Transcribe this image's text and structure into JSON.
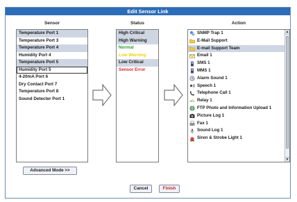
{
  "window": {
    "title": "Edit Sensor Link"
  },
  "columns": {
    "sensor": "Sensor",
    "status": "Status",
    "action": "Action"
  },
  "sensors": [
    "Temperature Port 1",
    "Temperature Port 3",
    "Temperature Port 4",
    "Humidity Port 4",
    "Temperature Port 5",
    "Humidity Port 5",
    "4-20mA Port 6",
    "Dry Contact Port 7",
    "Temperature Port 8",
    "Sound Detecter Port 1"
  ],
  "statuses": [
    {
      "label": "High Critical",
      "color": "#1a1a1a"
    },
    {
      "label": "High Warning",
      "color": "#1a1a1a"
    },
    {
      "label": "Normal",
      "color": "#2e9c2e"
    },
    {
      "label": "Low Warning",
      "color": "#e8d400"
    },
    {
      "label": "Low Critical",
      "color": "#1a1a1a"
    },
    {
      "label": "Sensor Error",
      "color": "#d12a2a"
    }
  ],
  "actions": [
    {
      "label": "SNMP Trap 1",
      "icon": "snmp-icon"
    },
    {
      "label": "E-Mail Support",
      "icon": "folder-icon"
    },
    {
      "label": "E-mail Support Team",
      "icon": "folder-icon"
    },
    {
      "label": "Email 1",
      "icon": "email-icon"
    },
    {
      "label": "SMS 1",
      "icon": "phone-icon"
    },
    {
      "label": "MMS 1",
      "icon": "phone-icon"
    },
    {
      "label": "Alarm Sound 1",
      "icon": "alarm-icon"
    },
    {
      "label": "Speech 1",
      "icon": "speech-icon"
    },
    {
      "label": "Telephone Call 1",
      "icon": "telephone-icon"
    },
    {
      "label": "Relay 1",
      "icon": "relay-icon"
    },
    {
      "label": "FTP Photo and Information Upload 1",
      "icon": "ftp-icon"
    },
    {
      "label": "Picture Log 1",
      "icon": "camera-icon"
    },
    {
      "label": "Fax 1",
      "icon": "fax-icon"
    },
    {
      "label": "Sound Log 1",
      "icon": "microphone-icon"
    },
    {
      "label": "Siren & Strobe Light 1",
      "icon": "siren-icon"
    }
  ],
  "buttons": {
    "advanced": "Advanced Mode >>",
    "cancel": "Cancel",
    "finish": "Finish"
  },
  "colors": {
    "accent": "#2c6db8",
    "selection": "#cfd6e3",
    "finish_text": "#c0262d"
  }
}
